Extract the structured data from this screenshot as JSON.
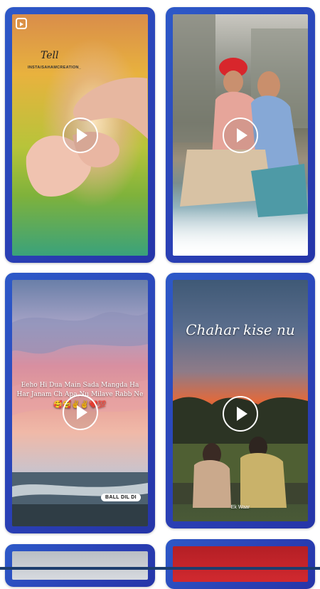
{
  "cards": [
    {
      "id": "card-1",
      "watermark": "INSTA/SAHAMCREATION_",
      "play_label": "play"
    },
    {
      "id": "card-2",
      "play_label": "play"
    },
    {
      "id": "card-3",
      "overlay_line1": "Eeho Hi Dua Main Sada Mangda Ha",
      "overlay_line2": "Har Janam Ch Apa Nu Milave Rabb Ne",
      "overlay_emojis": "🥰🥰✌️✌️❤️💯",
      "badge": "BALL DIL DI",
      "play_label": "play"
    },
    {
      "id": "card-4",
      "overlay_script": "Chahar kise nu",
      "overlay_small": "Ek Waar",
      "play_label": "play"
    },
    {
      "id": "card-5"
    },
    {
      "id": "card-6"
    }
  ],
  "colors": {
    "card_border": "#2a40b5",
    "play_ring": "#ffffff"
  },
  "icons": [
    "app-story-icon",
    "play-icon"
  ]
}
